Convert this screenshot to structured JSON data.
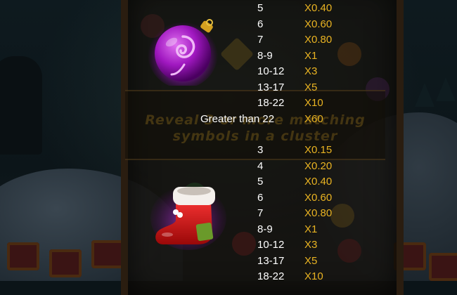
{
  "banner": {
    "text": "Reveal 3 or more matching\nsymbols in a cluster"
  },
  "symbols": [
    {
      "name": "purple-ornament",
      "icon": "purple-ornament-icon",
      "rows": [
        {
          "count": "5",
          "multiplier": "X0.40"
        },
        {
          "count": "6",
          "multiplier": "X0.60"
        },
        {
          "count": "7",
          "multiplier": "X0.80"
        },
        {
          "count": "8-9",
          "multiplier": "X1"
        },
        {
          "count": "10-12",
          "multiplier": "X3"
        },
        {
          "count": "13-17",
          "multiplier": "X5"
        },
        {
          "count": "18-22",
          "multiplier": "X10"
        },
        {
          "count": "Greater than 22",
          "multiplier": "X60"
        }
      ]
    },
    {
      "name": "red-stocking",
      "icon": "red-stocking-icon",
      "rows": [
        {
          "count": "3",
          "multiplier": "X0.15"
        },
        {
          "count": "4",
          "multiplier": "X0.20"
        },
        {
          "count": "5",
          "multiplier": "X0.40"
        },
        {
          "count": "6",
          "multiplier": "X0.60"
        },
        {
          "count": "7",
          "multiplier": "X0.80"
        },
        {
          "count": "8-9",
          "multiplier": "X1"
        },
        {
          "count": "10-12",
          "multiplier": "X3"
        },
        {
          "count": "13-17",
          "multiplier": "X5"
        },
        {
          "count": "18-22",
          "multiplier": "X10"
        }
      ]
    }
  ],
  "colors": {
    "count_text": "#ffffff",
    "multiplier_text": "#e9b322",
    "ornament": "#b020c8",
    "stocking": "#d01818"
  }
}
